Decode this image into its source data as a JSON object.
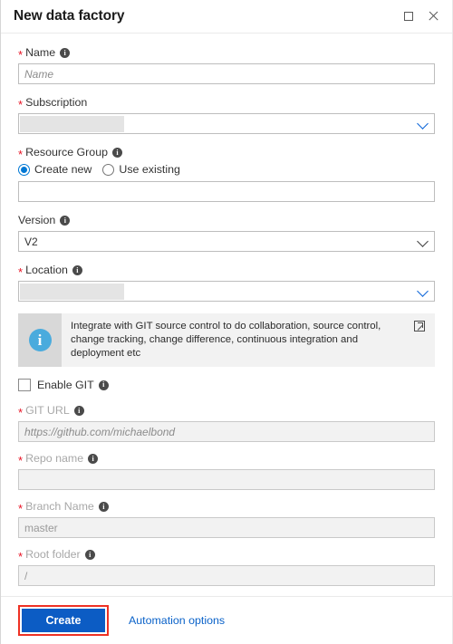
{
  "header": {
    "title": "New data factory",
    "maximize_icon": "maximize-square-icon",
    "close_icon": "close-x-icon"
  },
  "form": {
    "name": {
      "label": "Name",
      "required": true,
      "placeholder": "Name",
      "value": ""
    },
    "subscription": {
      "label": "Subscription",
      "required": true,
      "value": "",
      "redacted": true,
      "chevron": "chevron-down-icon"
    },
    "resource_group": {
      "label": "Resource Group",
      "required": true,
      "options": [
        {
          "label": "Create new",
          "selected": true
        },
        {
          "label": "Use existing",
          "selected": false
        }
      ],
      "value": ""
    },
    "version": {
      "label": "Version",
      "required": false,
      "value": "V2",
      "chevron": "chevron-down-icon"
    },
    "location": {
      "label": "Location",
      "required": true,
      "value": "",
      "redacted": true,
      "chevron": "chevron-down-icon"
    }
  },
  "banner": {
    "icon": "info-circle-icon",
    "text": "Integrate with GIT source control to do collaboration, source control, change tracking, change difference, continuous integration and deployment etc",
    "link_icon": "external-link-icon"
  },
  "git": {
    "enable": {
      "label": "Enable GIT",
      "checked": false
    },
    "url": {
      "label": "GIT URL",
      "required": true,
      "placeholder": "https://github.com/michaelbond",
      "value": "",
      "disabled": true
    },
    "repo_name": {
      "label": "Repo name",
      "required": true,
      "placeholder": "",
      "value": "",
      "disabled": true
    },
    "branch_name": {
      "label": "Branch Name",
      "required": true,
      "placeholder": "master",
      "value": "",
      "disabled": true
    },
    "root_folder": {
      "label": "Root folder",
      "required": true,
      "placeholder": "/",
      "value": "",
      "disabled": true
    }
  },
  "footer": {
    "create_label": "Create",
    "automation_label": "Automation options"
  },
  "colors": {
    "accent_blue": "#0078d4",
    "create_button": "#0c5cc4",
    "link_blue": "#0a62c9",
    "required_red": "#e81123",
    "highlight_red": "#ee3124",
    "banner_icon_blue": "#4aabdd"
  }
}
